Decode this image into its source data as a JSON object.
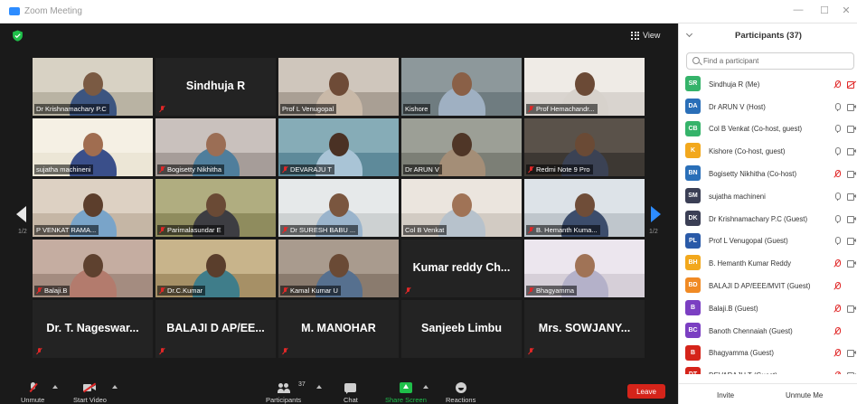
{
  "window": {
    "title": "Zoom Meeting",
    "minimize": "—",
    "maximize": "☐",
    "close": "✕"
  },
  "video": {
    "view_label": "View",
    "page_left": "1/2",
    "page_right": "1/2",
    "tiles": [
      {
        "label": "Dr Krishnamachary P.C",
        "type": "video",
        "bg": "#b9b3a3",
        "wall": "#d8d2c4",
        "skin": "#7a5a43",
        "shirt": "#3c5580",
        "muted": false
      },
      {
        "label": "Sindhuja R",
        "type": "name",
        "muted": true
      },
      {
        "label": "Prof L Venugopal",
        "type": "video",
        "bg": "#a99f94",
        "wall": "#cfc6bc",
        "skin": "#6e4b37",
        "shirt": "#c9b9a8",
        "muted": false
      },
      {
        "label": "Kishore",
        "type": "video",
        "bg": "#6f7c80",
        "wall": "#8d989b",
        "skin": "#8a6047",
        "shirt": "#9fb0c2",
        "muted": false
      },
      {
        "label": "Prof Hemachandr...",
        "type": "video",
        "bg": "#d9d4cf",
        "wall": "#efebe6",
        "skin": "#6b4a36",
        "shirt": "#d7d2cc",
        "muted": true
      },
      {
        "label": "sujatha machineni",
        "type": "video",
        "bg": "#ece6d6",
        "wall": "#f5f0e4",
        "skin": "#a06d50",
        "shirt": "#3a4f8a",
        "muted": false
      },
      {
        "label": "Bogisetty Nikhitha",
        "type": "video",
        "bg": "#a69d99",
        "wall": "#c9c1bd",
        "skin": "#9b6e55",
        "shirt": "#4f7e9c",
        "muted": true
      },
      {
        "label": "DEVARAJU T",
        "type": "video",
        "bg": "#5e8a9a",
        "wall": "#86acb7",
        "skin": "#4a3124",
        "shirt": "#a9c4d6",
        "muted": true
      },
      {
        "label": "Dr ARUN V",
        "type": "video",
        "bg": "#7c7f76",
        "wall": "#9c9f96",
        "skin": "#4f3627",
        "shirt": "#a48e77",
        "muted": false
      },
      {
        "label": "Redmi Note 9 Pro",
        "type": "video",
        "bg": "#3d3833",
        "wall": "#5a524a",
        "skin": "#6a4a35",
        "shirt": "#3b4254",
        "muted": true
      },
      {
        "label": "P VENKAT RAMA...",
        "type": "video",
        "bg": "#c5b6a5",
        "wall": "#ddd1c3",
        "skin": "#5c3e2c",
        "shirt": "#79a4c9",
        "muted": false,
        "speaking": true
      },
      {
        "label": "Parimalasundar E",
        "type": "video",
        "bg": "#8f8c5e",
        "wall": "#b0ad80",
        "skin": "#6a4a35",
        "shirt": "#3d3d42",
        "muted": true
      },
      {
        "label": "Dr SURESH BABU ...",
        "type": "video",
        "bg": "#cdd1d2",
        "wall": "#e6e9ea",
        "skin": "#7a563f",
        "shirt": "#9ab4cc",
        "muted": true
      },
      {
        "label": "Col B Venkat",
        "type": "video",
        "bg": "#d2cbc3",
        "wall": "#ebe5de",
        "skin": "#a07356",
        "shirt": "#b7c2cc",
        "muted": false
      },
      {
        "label": "B. Hemanth Kuma...",
        "type": "video",
        "bg": "#bfc6cc",
        "wall": "#dde3e8",
        "skin": "#6f4d38",
        "shirt": "#3c4d6c",
        "muted": true
      },
      {
        "label": "Balaji.B",
        "type": "video",
        "bg": "#a48c80",
        "wall": "#c5ada1",
        "skin": "#5e412f",
        "shirt": "#b37b6d",
        "muted": true
      },
      {
        "label": "Dr.C.Kumar",
        "type": "video",
        "bg": "#a69066",
        "wall": "#c8b48b",
        "skin": "#5a3e2c",
        "shirt": "#3f7d8a",
        "muted": true
      },
      {
        "label": "Kamal Kumar U",
        "type": "video",
        "bg": "#8a7b6e",
        "wall": "#a99b8e",
        "skin": "#6a4a35",
        "shirt": "#56708f",
        "muted": true
      },
      {
        "label": "Kumar reddy Ch...",
        "type": "name",
        "muted": true
      },
      {
        "label": "Bhagyamma",
        "type": "video",
        "bg": "#d6cfd8",
        "wall": "#ece6ee",
        "skin": "#a07356",
        "shirt": "#b4b1c9",
        "muted": true
      },
      {
        "label": "Dr. T. Nageswar...",
        "type": "name",
        "muted": true
      },
      {
        "label": "BALAJI D AP/EE...",
        "type": "name",
        "muted": true
      },
      {
        "label": "M. MANOHAR",
        "type": "name",
        "muted": true
      },
      {
        "label": "Sanjeeb Limbu",
        "type": "name",
        "muted": false
      },
      {
        "label": "Mrs. SOWJANY...",
        "type": "name",
        "muted": true
      }
    ]
  },
  "toolbar": {
    "unmute": "Unmute",
    "start_video": "Start Video",
    "participants": "Participants",
    "participants_count": "37",
    "chat": "Chat",
    "share_screen": "Share Screen",
    "reactions": "Reactions",
    "leave": "Leave"
  },
  "panel": {
    "title": "Participants (37)",
    "search_placeholder": "Find a participant",
    "invite": "Invite",
    "unmute_me": "Unmute Me",
    "participants": [
      {
        "initials": "SR",
        "color": "#35b36a",
        "name": "Sindhuja R (Me)",
        "mic": "off",
        "cam": "off"
      },
      {
        "initials": "DA",
        "color": "#2a6fb8",
        "name": "Dr ARUN V (Host)",
        "mic": "on",
        "cam": "on"
      },
      {
        "initials": "CB",
        "color": "#35b36a",
        "name": "Col B Venkat (Co-host, guest)",
        "mic": "on",
        "cam": "on"
      },
      {
        "initials": "K",
        "color": "#f2a81d",
        "name": "Kishore (Co-host, guest)",
        "mic": "on",
        "cam": "on"
      },
      {
        "initials": "BN",
        "color": "#2a6fb8",
        "name": "Bogisetty Nikhitha (Co-host)",
        "mic": "off",
        "cam": "on"
      },
      {
        "initials": "SM",
        "color": "#3b3f55",
        "name": "sujatha machineni",
        "mic": "on",
        "cam": "on"
      },
      {
        "initials": "DK",
        "color": "#3b3f55",
        "name": "Dr Krishnamachary P.C (Guest)",
        "mic": "on",
        "cam": "on"
      },
      {
        "initials": "PL",
        "color": "#2a5aa8",
        "name": "Prof L Venugopal (Guest)",
        "mic": "on",
        "cam": "on"
      },
      {
        "initials": "BH",
        "color": "#f2a81d",
        "name": "B. Hemanth Kumar Reddy",
        "mic": "off",
        "cam": "on"
      },
      {
        "initials": "BD",
        "color": "#f08a24",
        "name": "BALAJI D AP/EEE/MVIT (Guest)",
        "mic": "off",
        "cam": "none"
      },
      {
        "initials": "B",
        "color": "#7b3fc2",
        "name": "Balaji.B (Guest)",
        "mic": "off",
        "cam": "on"
      },
      {
        "initials": "BC",
        "color": "#7b3fc2",
        "name": "Banoth Chennaiah (Guest)",
        "mic": "off",
        "cam": "none"
      },
      {
        "initials": "B",
        "color": "#d5241a",
        "name": "Bhagyamma (Guest)",
        "mic": "off",
        "cam": "on"
      },
      {
        "initials": "DT",
        "color": "#d5241a",
        "name": "DEVARAJU T (Guest)",
        "mic": "off",
        "cam": "on"
      }
    ]
  }
}
